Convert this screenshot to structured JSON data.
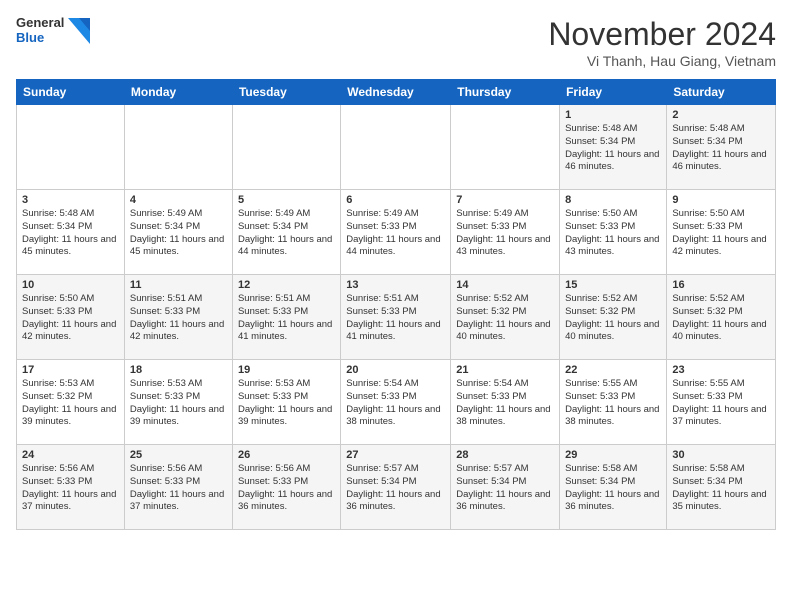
{
  "header": {
    "logo_general": "General",
    "logo_blue": "Blue",
    "month_title": "November 2024",
    "subtitle": "Vi Thanh, Hau Giang, Vietnam"
  },
  "columns": [
    "Sunday",
    "Monday",
    "Tuesday",
    "Wednesday",
    "Thursday",
    "Friday",
    "Saturday"
  ],
  "weeks": [
    [
      {
        "day": "",
        "info": ""
      },
      {
        "day": "",
        "info": ""
      },
      {
        "day": "",
        "info": ""
      },
      {
        "day": "",
        "info": ""
      },
      {
        "day": "",
        "info": ""
      },
      {
        "day": "1",
        "info": "Sunrise: 5:48 AM\nSunset: 5:34 PM\nDaylight: 11 hours and 46 minutes."
      },
      {
        "day": "2",
        "info": "Sunrise: 5:48 AM\nSunset: 5:34 PM\nDaylight: 11 hours and 46 minutes."
      }
    ],
    [
      {
        "day": "3",
        "info": "Sunrise: 5:48 AM\nSunset: 5:34 PM\nDaylight: 11 hours and 45 minutes."
      },
      {
        "day": "4",
        "info": "Sunrise: 5:49 AM\nSunset: 5:34 PM\nDaylight: 11 hours and 45 minutes."
      },
      {
        "day": "5",
        "info": "Sunrise: 5:49 AM\nSunset: 5:34 PM\nDaylight: 11 hours and 44 minutes."
      },
      {
        "day": "6",
        "info": "Sunrise: 5:49 AM\nSunset: 5:33 PM\nDaylight: 11 hours and 44 minutes."
      },
      {
        "day": "7",
        "info": "Sunrise: 5:49 AM\nSunset: 5:33 PM\nDaylight: 11 hours and 43 minutes."
      },
      {
        "day": "8",
        "info": "Sunrise: 5:50 AM\nSunset: 5:33 PM\nDaylight: 11 hours and 43 minutes."
      },
      {
        "day": "9",
        "info": "Sunrise: 5:50 AM\nSunset: 5:33 PM\nDaylight: 11 hours and 42 minutes."
      }
    ],
    [
      {
        "day": "10",
        "info": "Sunrise: 5:50 AM\nSunset: 5:33 PM\nDaylight: 11 hours and 42 minutes."
      },
      {
        "day": "11",
        "info": "Sunrise: 5:51 AM\nSunset: 5:33 PM\nDaylight: 11 hours and 42 minutes."
      },
      {
        "day": "12",
        "info": "Sunrise: 5:51 AM\nSunset: 5:33 PM\nDaylight: 11 hours and 41 minutes."
      },
      {
        "day": "13",
        "info": "Sunrise: 5:51 AM\nSunset: 5:33 PM\nDaylight: 11 hours and 41 minutes."
      },
      {
        "day": "14",
        "info": "Sunrise: 5:52 AM\nSunset: 5:32 PM\nDaylight: 11 hours and 40 minutes."
      },
      {
        "day": "15",
        "info": "Sunrise: 5:52 AM\nSunset: 5:32 PM\nDaylight: 11 hours and 40 minutes."
      },
      {
        "day": "16",
        "info": "Sunrise: 5:52 AM\nSunset: 5:32 PM\nDaylight: 11 hours and 40 minutes."
      }
    ],
    [
      {
        "day": "17",
        "info": "Sunrise: 5:53 AM\nSunset: 5:32 PM\nDaylight: 11 hours and 39 minutes."
      },
      {
        "day": "18",
        "info": "Sunrise: 5:53 AM\nSunset: 5:33 PM\nDaylight: 11 hours and 39 minutes."
      },
      {
        "day": "19",
        "info": "Sunrise: 5:53 AM\nSunset: 5:33 PM\nDaylight: 11 hours and 39 minutes."
      },
      {
        "day": "20",
        "info": "Sunrise: 5:54 AM\nSunset: 5:33 PM\nDaylight: 11 hours and 38 minutes."
      },
      {
        "day": "21",
        "info": "Sunrise: 5:54 AM\nSunset: 5:33 PM\nDaylight: 11 hours and 38 minutes."
      },
      {
        "day": "22",
        "info": "Sunrise: 5:55 AM\nSunset: 5:33 PM\nDaylight: 11 hours and 38 minutes."
      },
      {
        "day": "23",
        "info": "Sunrise: 5:55 AM\nSunset: 5:33 PM\nDaylight: 11 hours and 37 minutes."
      }
    ],
    [
      {
        "day": "24",
        "info": "Sunrise: 5:56 AM\nSunset: 5:33 PM\nDaylight: 11 hours and 37 minutes."
      },
      {
        "day": "25",
        "info": "Sunrise: 5:56 AM\nSunset: 5:33 PM\nDaylight: 11 hours and 37 minutes."
      },
      {
        "day": "26",
        "info": "Sunrise: 5:56 AM\nSunset: 5:33 PM\nDaylight: 11 hours and 36 minutes."
      },
      {
        "day": "27",
        "info": "Sunrise: 5:57 AM\nSunset: 5:34 PM\nDaylight: 11 hours and 36 minutes."
      },
      {
        "day": "28",
        "info": "Sunrise: 5:57 AM\nSunset: 5:34 PM\nDaylight: 11 hours and 36 minutes."
      },
      {
        "day": "29",
        "info": "Sunrise: 5:58 AM\nSunset: 5:34 PM\nDaylight: 11 hours and 36 minutes."
      },
      {
        "day": "30",
        "info": "Sunrise: 5:58 AM\nSunset: 5:34 PM\nDaylight: 11 hours and 35 minutes."
      }
    ]
  ]
}
